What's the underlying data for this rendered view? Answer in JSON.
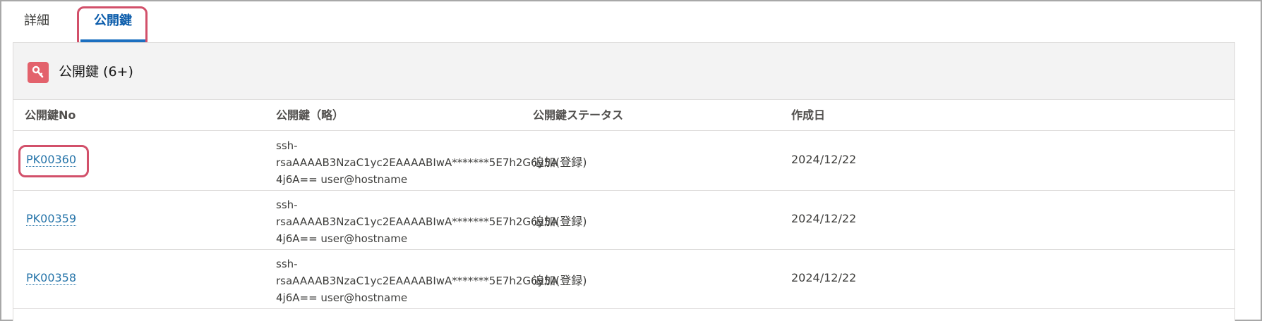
{
  "tabs": [
    {
      "label": "詳細",
      "active": false
    },
    {
      "label": "公開鍵",
      "active": true
    }
  ],
  "card": {
    "icon": "key-icon",
    "title": "公開鍵 (6+)",
    "icon_color": "#e3626c"
  },
  "table": {
    "columns": [
      "公開鍵No",
      "公開鍵（略）",
      "公開鍵ステータス",
      "作成日"
    ],
    "rows": [
      {
        "no": "PK00360",
        "key_line1": "ssh-",
        "key_line2": "rsaAAAAB3NzaC1yc2EAAAABIwA*******5E7h2G6y5A",
        "key_line3": "4j6A== user@hostname",
        "status": "追加(登録)",
        "date": "2024/12/22"
      },
      {
        "no": "PK00359",
        "key_line1": "ssh-",
        "key_line2": "rsaAAAAB3NzaC1yc2EAAAABIwA*******5E7h2G6y5A",
        "key_line3": "4j6A== user@hostname",
        "status": "追加(登録)",
        "date": "2024/12/22"
      },
      {
        "no": "PK00358",
        "key_line1": "ssh-",
        "key_line2": "rsaAAAAB3NzaC1yc2EAAAABIwA*******5E7h2G6y5A",
        "key_line3": "4j6A== user@hostname",
        "status": "追加(登録)",
        "date": "2024/12/22"
      }
    ]
  },
  "colors": {
    "link": "#2574a9",
    "active_tab": "#0b5cab",
    "highlight": "#d2506a"
  }
}
